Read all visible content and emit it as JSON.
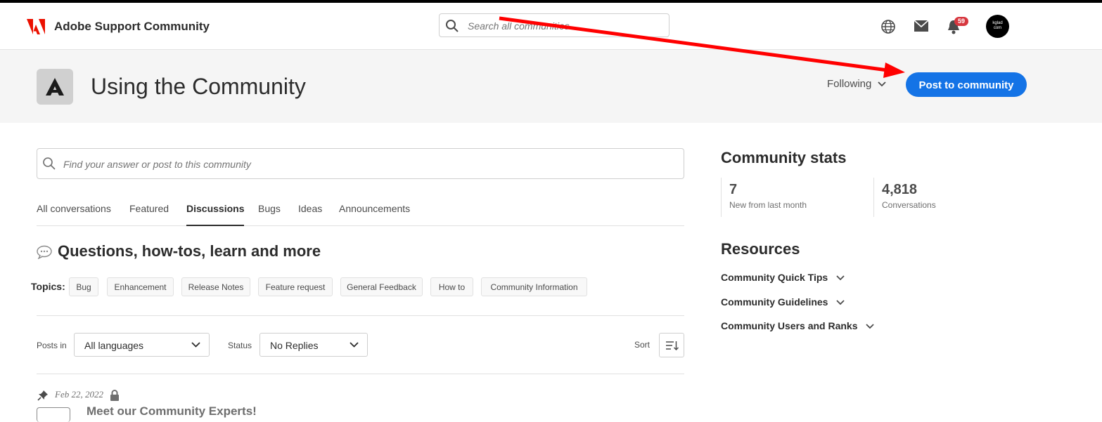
{
  "header": {
    "brand": "Adobe Support Community",
    "search_placeholder": "Search all communities",
    "notification_count": "59",
    "avatar_text_line1": "kglad",
    "avatar_text_line2": "com"
  },
  "community": {
    "title": "Using the Community",
    "following_label": "Following",
    "post_button": "Post to community",
    "accent_color": "#1473e6"
  },
  "main": {
    "search_placeholder": "Find your answer or post to this community",
    "tabs": [
      {
        "label": "All conversations"
      },
      {
        "label": "Featured"
      },
      {
        "label": "Discussions"
      },
      {
        "label": "Bugs"
      },
      {
        "label": "Ideas"
      },
      {
        "label": "Announcements"
      }
    ],
    "active_tab": "Discussions",
    "section_heading": "Questions, how-tos, learn and more",
    "topics_label": "Topics:",
    "topics": [
      "Bug",
      "Enhancement",
      "Release Notes",
      "Feature request",
      "General Feedback",
      "How to",
      "Community Information"
    ],
    "filters": {
      "posts_in_label": "Posts in",
      "posts_in_value": "All languages",
      "status_label": "Status",
      "status_value": "No Replies",
      "sort_label": "Sort"
    },
    "post": {
      "date": "Feb 22, 2022",
      "title": "Meet our Community Experts!"
    }
  },
  "sidebar": {
    "stats_title": "Community stats",
    "stats": [
      {
        "value": "7",
        "label": "New from last month"
      },
      {
        "value": "4,818",
        "label": "Conversations"
      }
    ],
    "resources_title": "Resources",
    "resources": [
      "Community Quick Tips",
      "Community Guidelines",
      "Community Users and Ranks"
    ]
  }
}
